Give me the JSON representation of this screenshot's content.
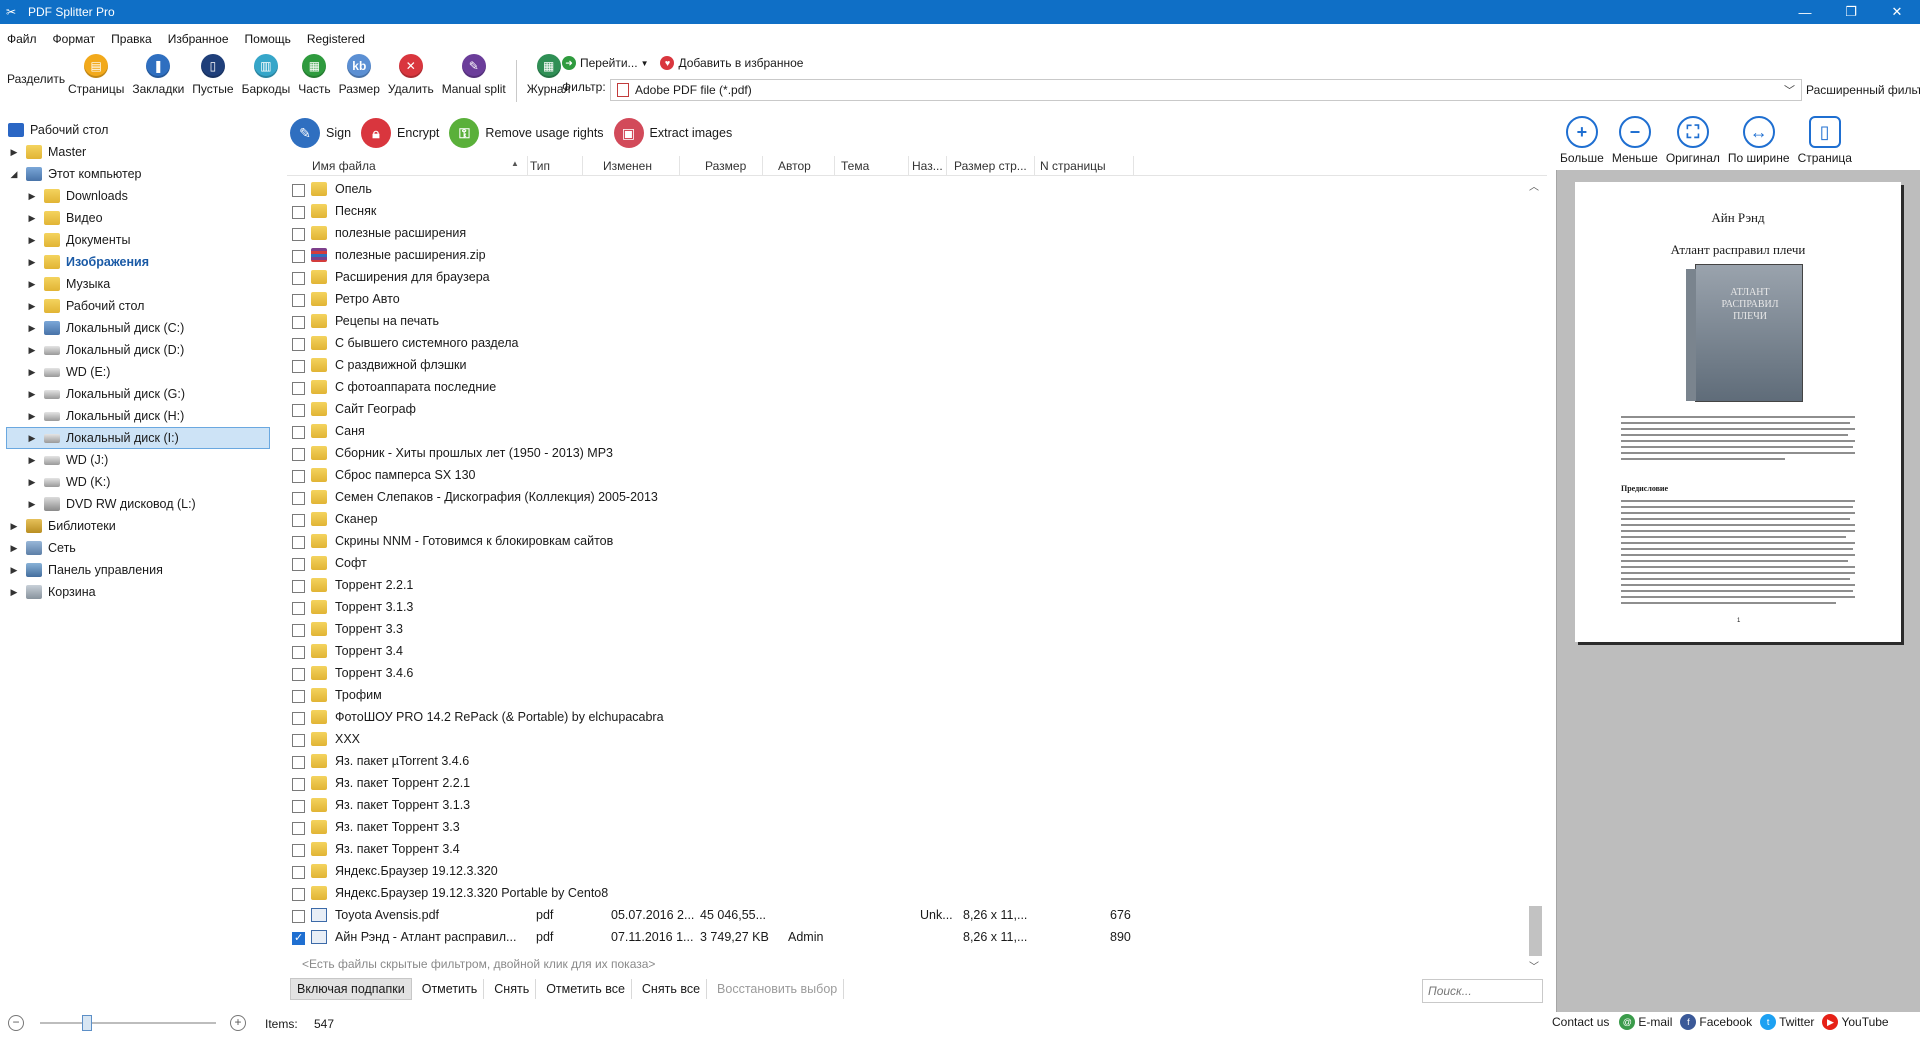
{
  "window": {
    "title": "PDF Splitter Pro"
  },
  "menu": [
    "Файл",
    "Формат",
    "Правка",
    "Избранное",
    "Помощь",
    "Registered"
  ],
  "toolbar": {
    "split_label": "Разделить",
    "buttons": [
      "Страницы",
      "Закладки",
      "Пустые",
      "Баркоды",
      "Часть",
      "Размер",
      "Удалить",
      "Manual split",
      "Журнал"
    ],
    "goto_label": "Перейти...",
    "add_favorites_label": "Добавить в избранное",
    "filter_label": "Фильтр:",
    "filter_value": "Adobe PDF file (*.pdf)",
    "advanced_filter_label": "Расширенный фильтр"
  },
  "tree": {
    "items": [
      "Рабочий стол",
      "Master",
      "Этот компьютер",
      "Downloads",
      "Видео",
      "Документы",
      "Изображения",
      "Музыка",
      "Рабочий стол",
      "Локальный диск (C:)",
      "Локальный диск (D:)",
      "WD (E:)",
      "Локальный диск (G:)",
      "Локальный диск (H:)",
      "Локальный диск (I:)",
      "WD (J:)",
      "WD (K:)",
      "DVD RW дисковод (L:)",
      "Библиотеки",
      "Сеть",
      "Панель управления",
      "Корзина"
    ]
  },
  "actions": [
    "Sign",
    "Encrypt",
    "Remove usage rights",
    "Extract images"
  ],
  "columns": [
    "Имя файла",
    "Тип",
    "Изменен",
    "Размер",
    "Автор",
    "Тема",
    "Наз...",
    "Размер стр...",
    "N страницы"
  ],
  "files": [
    {
      "name": "Опель"
    },
    {
      "name": "Песняк"
    },
    {
      "name": "полезные расширения"
    },
    {
      "name": "полезные расширения.zip"
    },
    {
      "name": "Расширения для браузера"
    },
    {
      "name": "Ретро Авто"
    },
    {
      "name": "Рецепы на печать"
    },
    {
      "name": "С бывшего системного раздела"
    },
    {
      "name": "С раздвижной флэшки"
    },
    {
      "name": "С фотоаппарата последние"
    },
    {
      "name": "Сайт Географ"
    },
    {
      "name": "Саня"
    },
    {
      "name": "Сборник - Хиты прошлых лет (1950 - 2013) MP3"
    },
    {
      "name": "Сброс памперса SX 130"
    },
    {
      "name": "Семен Слепаков - Дискография (Коллекция) 2005-2013"
    },
    {
      "name": "Сканер"
    },
    {
      "name": "Скрины NNM - Готовимся к блокировкам сайтов"
    },
    {
      "name": "Софт"
    },
    {
      "name": "Торрент 2.2.1"
    },
    {
      "name": "Торрент 3.1.3"
    },
    {
      "name": "Торрент 3.3"
    },
    {
      "name": "Торрент 3.4"
    },
    {
      "name": "Торрент 3.4.6"
    },
    {
      "name": "Трофим"
    },
    {
      "name": "ФотоШОУ PRO 14.2 RePack (& Portable) by elchupacabra"
    },
    {
      "name": "XXX"
    },
    {
      "name": "Яз. пакет µTorrent 3.4.6"
    },
    {
      "name": "Яз. пакет Торрент 2.2.1"
    },
    {
      "name": "Яз. пакет Торрент 3.1.3"
    },
    {
      "name": "Яз. пакет Торрент 3.3"
    },
    {
      "name": "Яз. пакет Торрент 3.4"
    },
    {
      "name": "Яндекс.Браузер 19.12.3.320"
    },
    {
      "name": "Яндекс.Браузер 19.12.3.320 Portable by Cento8"
    },
    {
      "name": "Toyota Avensis.pdf",
      "type": "pdf",
      "modified": "05.07.2016 2...",
      "size": "45 046,55...",
      "author": "",
      "title": "Unk...",
      "pagesize": "8,26 x 11,...",
      "pages": "676"
    },
    {
      "name": "Айн Рэнд - Атлант расправил...",
      "type": "pdf",
      "modified": "07.11.2016 1...",
      "size": "3 749,27 KB",
      "author": "Admin",
      "title": "",
      "pagesize": "8,26 x 11,...",
      "pages": "890",
      "checked": true
    }
  ],
  "hidden_note": "<Есть файлы скрытые фильтром, двойной клик для их показа>",
  "list_buttons": [
    "Включая подпапки",
    "Отметить",
    "Снять",
    "Отметить все",
    "Снять все",
    "Восстановить выбор"
  ],
  "search_placeholder": "Поиск...",
  "status": {
    "items_label": "Items:",
    "items_value": "547"
  },
  "view_buttons": [
    "Больше",
    "Меньше",
    "Оригинал",
    "По ширине",
    "Страница"
  ],
  "preview": {
    "author": "Айн Рэнд",
    "book_title": "Атлант расправил плечи",
    "cover_text": "АТЛАНТ РАСПРАВИЛ ПЛЕЧИ",
    "preface_heading": "Предисловие",
    "page_number": "1"
  },
  "contact": {
    "label": "Contact us",
    "links": [
      "E-mail",
      "Facebook",
      "Twitter",
      "YouTube"
    ]
  }
}
